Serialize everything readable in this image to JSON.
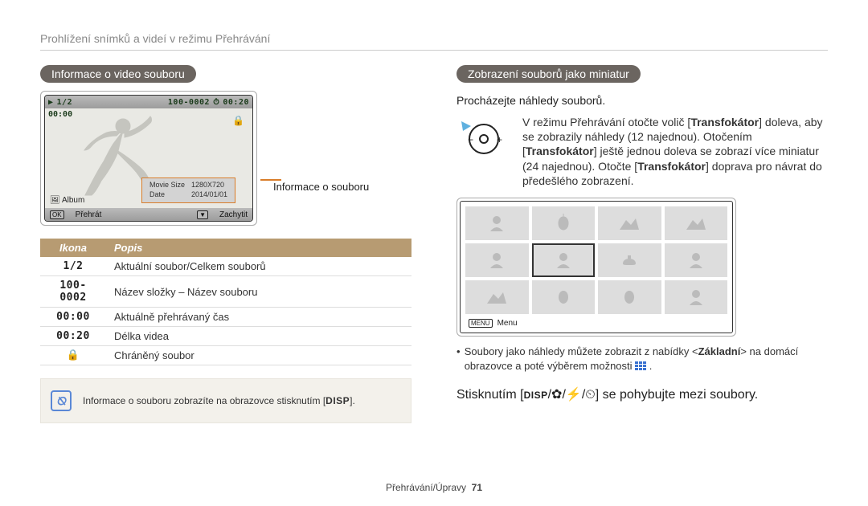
{
  "breadcrumb": "Prohlížení snímků a videí v režimu Přehrávání",
  "left": {
    "section_title": "Informace o video souboru",
    "cam_topbar": {
      "file_counter": "1/2",
      "folder_file": "100-0002",
      "total_time": "00:20"
    },
    "elapsed": "00:00",
    "info_rows": {
      "r1_label": "Movie Size",
      "r1_val": "1280X720",
      "r2_label": "Date",
      "r2_val": "2014/01/01"
    },
    "album_label": "Album",
    "play_label": "Přehrát",
    "capture_label": "Zachytit",
    "callout_label": "Informace o souboru",
    "table": {
      "h_icon": "Ikona",
      "h_desc": "Popis",
      "row1_icon": "1/2",
      "row1_desc": "Aktuální soubor/Celkem souborů",
      "row2_icon": "100-0002",
      "row2_desc": "Název složky – Název souboru",
      "row3_icon": "00:00",
      "row3_desc": "Aktuálně přehrávaný čas",
      "row4_icon": "00:20",
      "row4_desc": "Délka videa",
      "row5_icon": "🔒",
      "row5_desc": "Chráněný soubor"
    },
    "note_text_a": "Informace o souboru zobrazíte na obrazovce stisknutím [",
    "note_btn": "DISP",
    "note_text_b": "]."
  },
  "right": {
    "section_title": "Zobrazení souborů jako miniatur",
    "sub": "Procházejte náhledy souborů.",
    "trans_a": "V režimu Přehrávání otočte volič [",
    "trans_b": "] doleva, aby se zobrazily náhledy (12 najednou). Otočením [",
    "trans_c": "] ještě jednou doleva se zobrazí více miniatur (24 najednou). Otočte [",
    "trans_d": "] doprava pro návrat do předešlého zobrazení.",
    "trans_bold": "Transfokátor",
    "menu_btn": "MENU",
    "menu_label": "Menu",
    "bullet_a": "Soubory jako náhledy můžete zobrazit z nabídky <",
    "bullet_bold": "Základní",
    "bullet_b": "> na domácí obrazovce a poté výběrem možnosti ",
    "bullet_end": ".",
    "nav_a": "Stisknutím [",
    "nav_b": "] se pohybujte mezi soubory.",
    "nav_btn": "DISP"
  },
  "footer": {
    "section": "Přehrávání/Úpravy",
    "page": "71"
  }
}
